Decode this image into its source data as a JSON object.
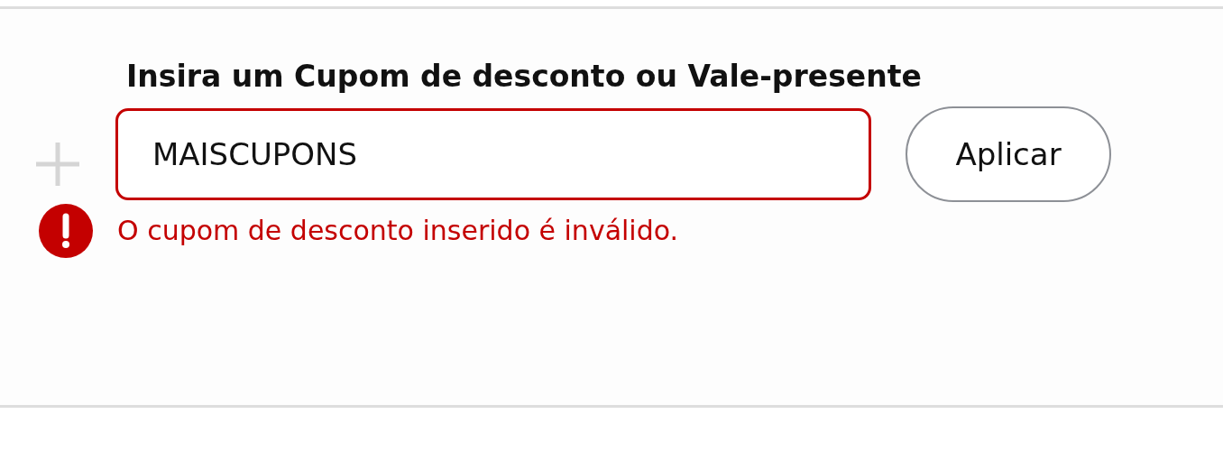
{
  "coupon_form": {
    "label": "Insira um Cupom de desconto ou Vale-presente",
    "field": {
      "value": "MAISCUPONS",
      "invalid": true
    },
    "apply_button": "Aplicar",
    "error": "O cupom de desconto inserido é inválido."
  }
}
